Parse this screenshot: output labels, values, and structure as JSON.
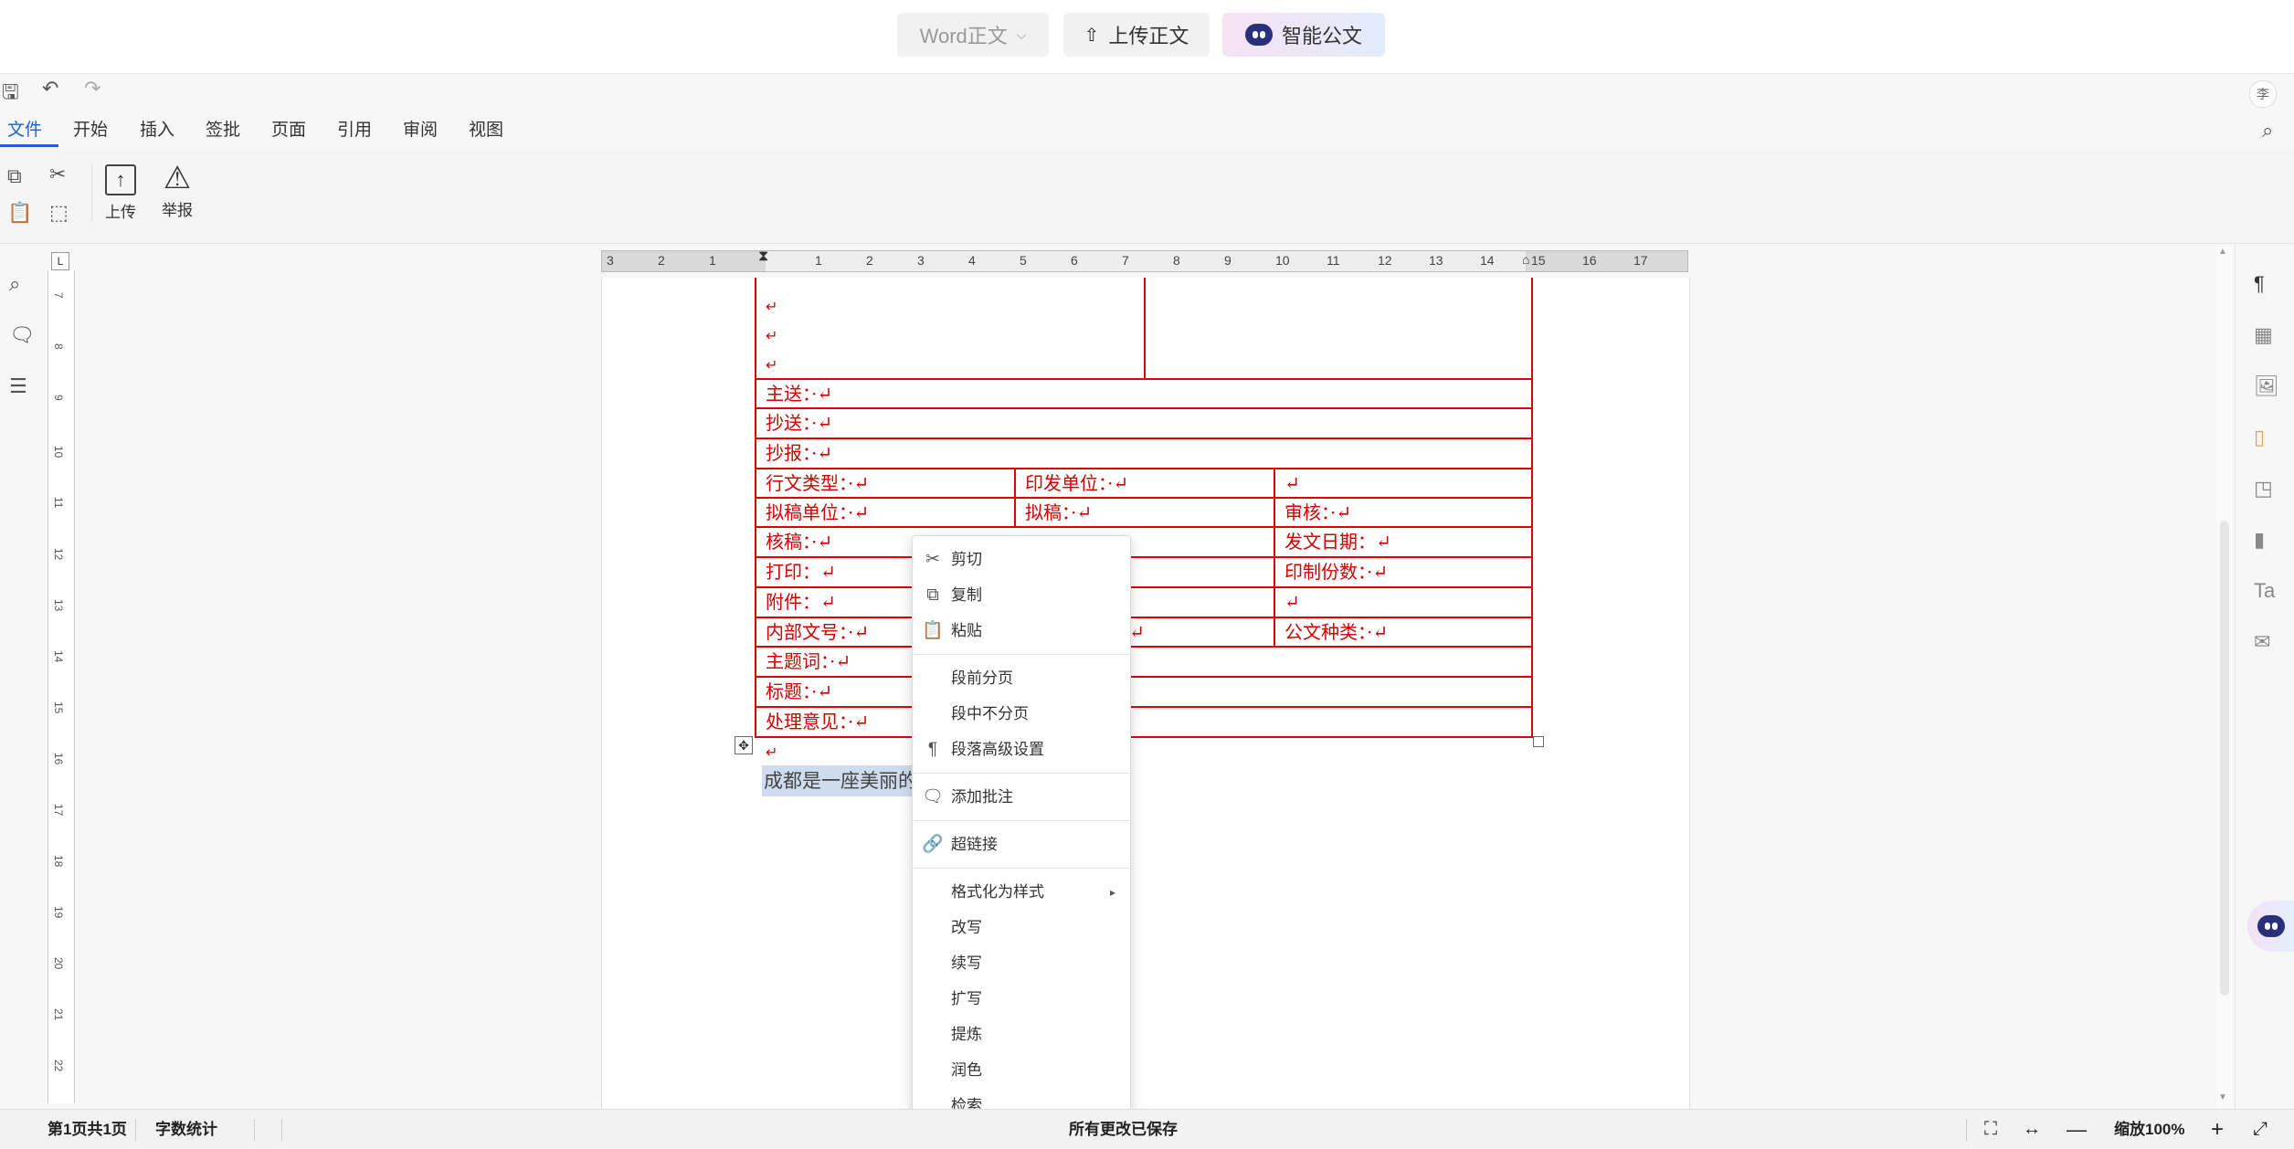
{
  "header": {
    "word_select": "Word正文",
    "upload_body": "上传正文",
    "smart_doc": "智能公文"
  },
  "menu_tabs": [
    "文件",
    "开始",
    "插入",
    "签批",
    "页面",
    "引用",
    "审阅",
    "视图"
  ],
  "avatar_text": "李",
  "ribbon": {
    "upload": "上传",
    "report": "举报"
  },
  "ruler_h": [
    "3",
    "2",
    "1",
    "1",
    "2",
    "3",
    "4",
    "5",
    "6",
    "7",
    "8",
    "9",
    "10",
    "11",
    "12",
    "13",
    "14",
    "15",
    "16",
    "17"
  ],
  "ruler_v": [
    "7",
    "8",
    "9",
    "10",
    "11",
    "12",
    "13",
    "14",
    "15",
    "16",
    "17",
    "18",
    "19",
    "20",
    "21",
    "22"
  ],
  "table": {
    "main_send": "主送：·↵",
    "copy_send": "抄送：·↵",
    "report_to": "抄报：·↵",
    "doc_type": "行文类型：·↵",
    "issue_unit": "印发单位：·↵",
    "blank1": "↵",
    "draft_unit": "拟稿单位：·↵",
    "drafter": "拟稿：·↵",
    "reviewer": "审核：·↵",
    "checker": "核稿：·↵",
    "issue_date": "发文日期：↵",
    "print": "打印：↵",
    "print_copies": "印制份数：·↵",
    "attachment": "附件：↵",
    "blank2": "↵",
    "internal_no": "内部文号：·↵",
    "internal_tail": "↵",
    "doc_kind": "公文种类：·↵",
    "subject": "主题词：·↵",
    "title": "标题：·↵",
    "opinion": "处理意见：·↵"
  },
  "body_text": "成都是一座美丽的",
  "context_menu": {
    "cut": "剪切",
    "copy": "复制",
    "paste": "粘贴",
    "page_before": "段前分页",
    "keep_together": "段中不分页",
    "para_advanced": "段落高级设置",
    "add_comment": "添加批注",
    "hyperlink": "超链接",
    "format_style": "格式化为样式",
    "rewrite": "改写",
    "continue": "续写",
    "expand": "扩写",
    "refine": "提炼",
    "polish": "润色",
    "retrieve": "检索"
  },
  "status": {
    "pages": "第1页共1页",
    "word_count": "字数统计",
    "saved": "所有更改已保存",
    "zoom": "缩放100%"
  }
}
